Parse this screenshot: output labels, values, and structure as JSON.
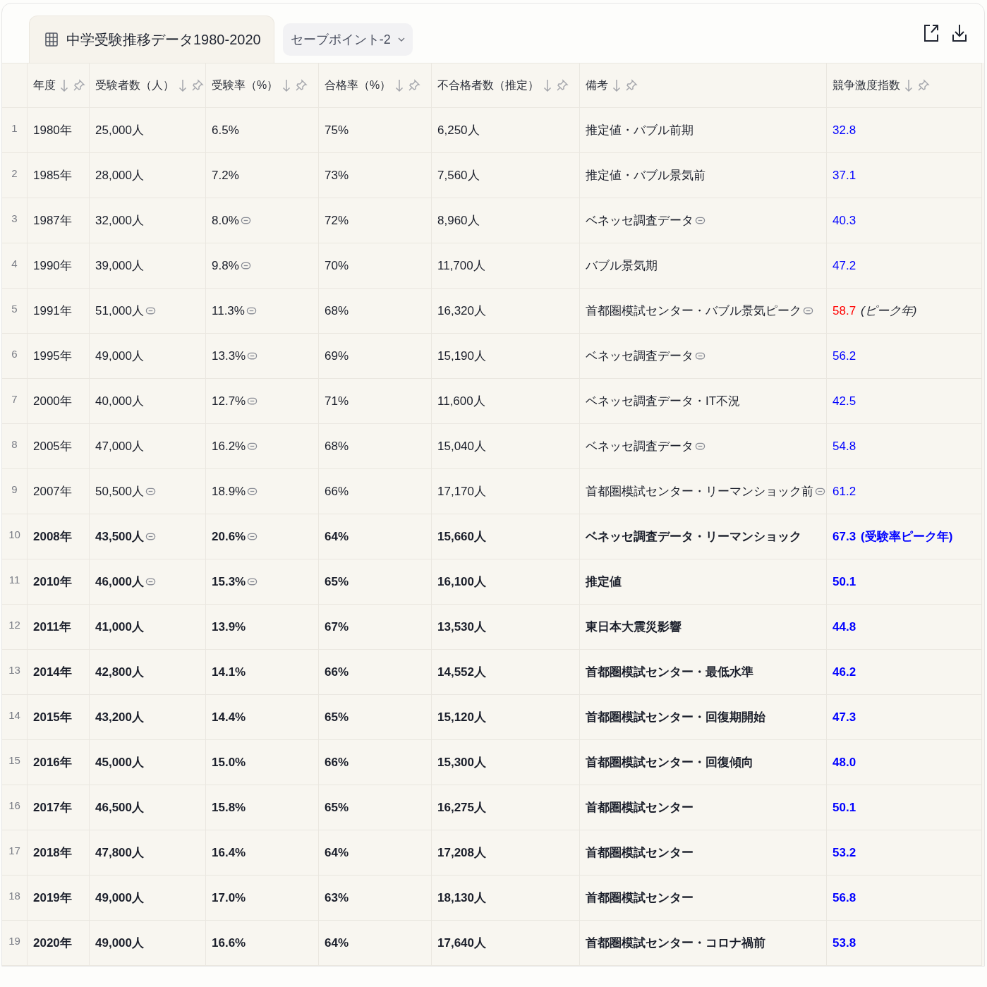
{
  "tabs": [
    {
      "label": "中学受験推移データ1980-2020",
      "selected": true,
      "kind": "sheet"
    },
    {
      "label": "セーブポイント-2",
      "selected": false,
      "kind": "dropdown"
    }
  ],
  "table": {
    "columns": [
      "年度",
      "受験者数（人）",
      "受験率（%）",
      "合格率（%）",
      "不合格者数（推定）",
      "備考",
      "競争激度指数"
    ],
    "rows": [
      {
        "number": "1",
        "bold": false,
        "cells": [
          {
            "text": "1980年"
          },
          {
            "text": "25,000人"
          },
          {
            "text": "6.5%"
          },
          {
            "text": "75%"
          },
          {
            "text": "6,250人"
          },
          {
            "text": "推定値・バブル前期"
          }
        ],
        "index": {
          "value": "32.8",
          "color": "#0000ff"
        }
      },
      {
        "number": "2",
        "bold": false,
        "cells": [
          {
            "text": "1985年"
          },
          {
            "text": "28,000人"
          },
          {
            "text": "7.2%"
          },
          {
            "text": "73%"
          },
          {
            "text": "7,560人"
          },
          {
            "text": "推定値・バブル景気前"
          }
        ],
        "index": {
          "value": "37.1",
          "color": "#0000ff"
        }
      },
      {
        "number": "3",
        "bold": false,
        "cells": [
          {
            "text": "1987年"
          },
          {
            "text": "32,000人"
          },
          {
            "text": "8.0%",
            "cited": true
          },
          {
            "text": "72%"
          },
          {
            "text": "8,960人"
          },
          {
            "text": "ベネッセ調査データ",
            "cited": true
          }
        ],
        "index": {
          "value": "40.3",
          "color": "#0000ff"
        }
      },
      {
        "number": "4",
        "bold": false,
        "cells": [
          {
            "text": "1990年"
          },
          {
            "text": "39,000人"
          },
          {
            "text": "9.8%",
            "cited": true
          },
          {
            "text": "70%"
          },
          {
            "text": "11,700人"
          },
          {
            "text": "バブル景気期"
          }
        ],
        "index": {
          "value": "47.2",
          "color": "#0000ff"
        }
      },
      {
        "number": "5",
        "bold": false,
        "cells": [
          {
            "text": "1991年"
          },
          {
            "text": "51,000人",
            "cited": true
          },
          {
            "text": "11.3%",
            "cited": true
          },
          {
            "text": "68%"
          },
          {
            "text": "16,320人"
          },
          {
            "text": "首都圏模試センター・バブル景気ピーク",
            "cited": true
          }
        ],
        "index": {
          "value": "58.7",
          "color": "#ff0000",
          "note": "(ピーク年)",
          "note_italic": true
        }
      },
      {
        "number": "6",
        "bold": false,
        "cells": [
          {
            "text": "1995年"
          },
          {
            "text": "49,000人"
          },
          {
            "text": "13.3%",
            "cited": true
          },
          {
            "text": "69%"
          },
          {
            "text": "15,190人"
          },
          {
            "text": "ベネッセ調査データ",
            "cited": true
          }
        ],
        "index": {
          "value": "56.2",
          "color": "#0000ff"
        }
      },
      {
        "number": "7",
        "bold": false,
        "cells": [
          {
            "text": "2000年"
          },
          {
            "text": "40,000人"
          },
          {
            "text": "12.7%",
            "cited": true
          },
          {
            "text": "71%"
          },
          {
            "text": "11,600人"
          },
          {
            "text": "ベネッセ調査データ・IT不況"
          }
        ],
        "index": {
          "value": "42.5",
          "color": "#0000ff"
        }
      },
      {
        "number": "8",
        "bold": false,
        "cells": [
          {
            "text": "2005年"
          },
          {
            "text": "47,000人"
          },
          {
            "text": "16.2%",
            "cited": true
          },
          {
            "text": "68%"
          },
          {
            "text": "15,040人"
          },
          {
            "text": "ベネッセ調査データ",
            "cited": true
          }
        ],
        "index": {
          "value": "54.8",
          "color": "#0000ff"
        }
      },
      {
        "number": "9",
        "bold": false,
        "cells": [
          {
            "text": "2007年"
          },
          {
            "text": "50,500人",
            "cited": true
          },
          {
            "text": "18.9%",
            "cited": true
          },
          {
            "text": "66%"
          },
          {
            "text": "17,170人"
          },
          {
            "text": "首都圏模試センター・リーマンショック前",
            "cited": true
          }
        ],
        "index": {
          "value": "61.2",
          "color": "#0000ff"
        }
      },
      {
        "number": "10",
        "bold": true,
        "cells": [
          {
            "text": "2008年"
          },
          {
            "text": "43,500人",
            "cited": true
          },
          {
            "text": "20.6%",
            "cited": true
          },
          {
            "text": "64%"
          },
          {
            "text": "15,660人"
          },
          {
            "text": "ベネッセ調査データ・リーマンショック"
          }
        ],
        "index": {
          "value": "67.3",
          "color": "#0000ff",
          "note": "(受験率ピーク年)",
          "note_italic": false
        }
      },
      {
        "number": "11",
        "bold": true,
        "cells": [
          {
            "text": "2010年"
          },
          {
            "text": "46,000人",
            "cited": true
          },
          {
            "text": "15.3%",
            "cited": true
          },
          {
            "text": "65%"
          },
          {
            "text": "16,100人"
          },
          {
            "text": "推定値"
          }
        ],
        "index": {
          "value": "50.1",
          "color": "#0000ff"
        }
      },
      {
        "number": "12",
        "bold": true,
        "cells": [
          {
            "text": "2011年"
          },
          {
            "text": "41,000人"
          },
          {
            "text": "13.9%"
          },
          {
            "text": "67%"
          },
          {
            "text": "13,530人"
          },
          {
            "text": "東日本大震災影響"
          }
        ],
        "index": {
          "value": "44.8",
          "color": "#0000ff"
        }
      },
      {
        "number": "13",
        "bold": true,
        "cells": [
          {
            "text": "2014年"
          },
          {
            "text": "42,800人"
          },
          {
            "text": "14.1%"
          },
          {
            "text": "66%"
          },
          {
            "text": "14,552人"
          },
          {
            "text": "首都圏模試センター・最低水準"
          }
        ],
        "index": {
          "value": "46.2",
          "color": "#0000ff"
        }
      },
      {
        "number": "14",
        "bold": true,
        "cells": [
          {
            "text": "2015年"
          },
          {
            "text": "43,200人"
          },
          {
            "text": "14.4%"
          },
          {
            "text": "65%"
          },
          {
            "text": "15,120人"
          },
          {
            "text": "首都圏模試センター・回復期開始"
          }
        ],
        "index": {
          "value": "47.3",
          "color": "#0000ff"
        }
      },
      {
        "number": "15",
        "bold": true,
        "cells": [
          {
            "text": "2016年"
          },
          {
            "text": "45,000人"
          },
          {
            "text": "15.0%"
          },
          {
            "text": "66%"
          },
          {
            "text": "15,300人"
          },
          {
            "text": "首都圏模試センター・回復傾向"
          }
        ],
        "index": {
          "value": "48.0",
          "color": "#0000ff"
        }
      },
      {
        "number": "16",
        "bold": true,
        "cells": [
          {
            "text": "2017年"
          },
          {
            "text": "46,500人"
          },
          {
            "text": "15.8%"
          },
          {
            "text": "65%"
          },
          {
            "text": "16,275人"
          },
          {
            "text": "首都圏模試センター"
          }
        ],
        "index": {
          "value": "50.1",
          "color": "#0000ff"
        }
      },
      {
        "number": "17",
        "bold": true,
        "cells": [
          {
            "text": "2018年"
          },
          {
            "text": "47,800人"
          },
          {
            "text": "16.4%"
          },
          {
            "text": "64%"
          },
          {
            "text": "17,208人"
          },
          {
            "text": "首都圏模試センター"
          }
        ],
        "index": {
          "value": "53.2",
          "color": "#0000ff"
        }
      },
      {
        "number": "18",
        "bold": true,
        "cells": [
          {
            "text": "2019年"
          },
          {
            "text": "49,000人"
          },
          {
            "text": "17.0%"
          },
          {
            "text": "63%"
          },
          {
            "text": "18,130人"
          },
          {
            "text": "首都圏模試センター"
          }
        ],
        "index": {
          "value": "56.8",
          "color": "#0000ff"
        }
      },
      {
        "number": "19",
        "bold": true,
        "cells": [
          {
            "text": "2020年"
          },
          {
            "text": "49,000人"
          },
          {
            "text": "16.6%"
          },
          {
            "text": "64%"
          },
          {
            "text": "17,640人"
          },
          {
            "text": "首都圏模試センター・コロナ禍前"
          }
        ],
        "index": {
          "value": "53.8",
          "color": "#0000ff"
        }
      }
    ]
  }
}
